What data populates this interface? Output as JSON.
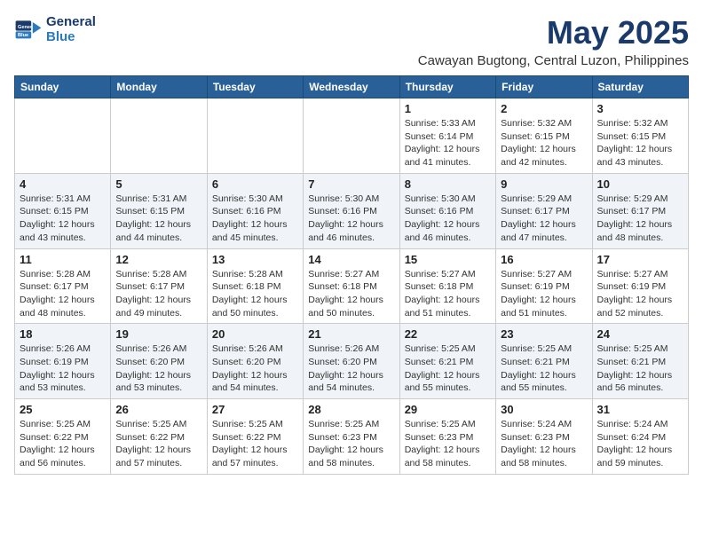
{
  "logo": {
    "line1": "General",
    "line2": "Blue"
  },
  "title": "May 2025",
  "subtitle": "Cawayan Bugtong, Central Luzon, Philippines",
  "days_of_week": [
    "Sunday",
    "Monday",
    "Tuesday",
    "Wednesday",
    "Thursday",
    "Friday",
    "Saturday"
  ],
  "weeks": [
    [
      {
        "day": "",
        "info": ""
      },
      {
        "day": "",
        "info": ""
      },
      {
        "day": "",
        "info": ""
      },
      {
        "day": "",
        "info": ""
      },
      {
        "day": "1",
        "info": "Sunrise: 5:33 AM\nSunset: 6:14 PM\nDaylight: 12 hours\nand 41 minutes."
      },
      {
        "day": "2",
        "info": "Sunrise: 5:32 AM\nSunset: 6:15 PM\nDaylight: 12 hours\nand 42 minutes."
      },
      {
        "day": "3",
        "info": "Sunrise: 5:32 AM\nSunset: 6:15 PM\nDaylight: 12 hours\nand 43 minutes."
      }
    ],
    [
      {
        "day": "4",
        "info": "Sunrise: 5:31 AM\nSunset: 6:15 PM\nDaylight: 12 hours\nand 43 minutes."
      },
      {
        "day": "5",
        "info": "Sunrise: 5:31 AM\nSunset: 6:15 PM\nDaylight: 12 hours\nand 44 minutes."
      },
      {
        "day": "6",
        "info": "Sunrise: 5:30 AM\nSunset: 6:16 PM\nDaylight: 12 hours\nand 45 minutes."
      },
      {
        "day": "7",
        "info": "Sunrise: 5:30 AM\nSunset: 6:16 PM\nDaylight: 12 hours\nand 46 minutes."
      },
      {
        "day": "8",
        "info": "Sunrise: 5:30 AM\nSunset: 6:16 PM\nDaylight: 12 hours\nand 46 minutes."
      },
      {
        "day": "9",
        "info": "Sunrise: 5:29 AM\nSunset: 6:17 PM\nDaylight: 12 hours\nand 47 minutes."
      },
      {
        "day": "10",
        "info": "Sunrise: 5:29 AM\nSunset: 6:17 PM\nDaylight: 12 hours\nand 48 minutes."
      }
    ],
    [
      {
        "day": "11",
        "info": "Sunrise: 5:28 AM\nSunset: 6:17 PM\nDaylight: 12 hours\nand 48 minutes."
      },
      {
        "day": "12",
        "info": "Sunrise: 5:28 AM\nSunset: 6:17 PM\nDaylight: 12 hours\nand 49 minutes."
      },
      {
        "day": "13",
        "info": "Sunrise: 5:28 AM\nSunset: 6:18 PM\nDaylight: 12 hours\nand 50 minutes."
      },
      {
        "day": "14",
        "info": "Sunrise: 5:27 AM\nSunset: 6:18 PM\nDaylight: 12 hours\nand 50 minutes."
      },
      {
        "day": "15",
        "info": "Sunrise: 5:27 AM\nSunset: 6:18 PM\nDaylight: 12 hours\nand 51 minutes."
      },
      {
        "day": "16",
        "info": "Sunrise: 5:27 AM\nSunset: 6:19 PM\nDaylight: 12 hours\nand 51 minutes."
      },
      {
        "day": "17",
        "info": "Sunrise: 5:27 AM\nSunset: 6:19 PM\nDaylight: 12 hours\nand 52 minutes."
      }
    ],
    [
      {
        "day": "18",
        "info": "Sunrise: 5:26 AM\nSunset: 6:19 PM\nDaylight: 12 hours\nand 53 minutes."
      },
      {
        "day": "19",
        "info": "Sunrise: 5:26 AM\nSunset: 6:20 PM\nDaylight: 12 hours\nand 53 minutes."
      },
      {
        "day": "20",
        "info": "Sunrise: 5:26 AM\nSunset: 6:20 PM\nDaylight: 12 hours\nand 54 minutes."
      },
      {
        "day": "21",
        "info": "Sunrise: 5:26 AM\nSunset: 6:20 PM\nDaylight: 12 hours\nand 54 minutes."
      },
      {
        "day": "22",
        "info": "Sunrise: 5:25 AM\nSunset: 6:21 PM\nDaylight: 12 hours\nand 55 minutes."
      },
      {
        "day": "23",
        "info": "Sunrise: 5:25 AM\nSunset: 6:21 PM\nDaylight: 12 hours\nand 55 minutes."
      },
      {
        "day": "24",
        "info": "Sunrise: 5:25 AM\nSunset: 6:21 PM\nDaylight: 12 hours\nand 56 minutes."
      }
    ],
    [
      {
        "day": "25",
        "info": "Sunrise: 5:25 AM\nSunset: 6:22 PM\nDaylight: 12 hours\nand 56 minutes."
      },
      {
        "day": "26",
        "info": "Sunrise: 5:25 AM\nSunset: 6:22 PM\nDaylight: 12 hours\nand 57 minutes."
      },
      {
        "day": "27",
        "info": "Sunrise: 5:25 AM\nSunset: 6:22 PM\nDaylight: 12 hours\nand 57 minutes."
      },
      {
        "day": "28",
        "info": "Sunrise: 5:25 AM\nSunset: 6:23 PM\nDaylight: 12 hours\nand 58 minutes."
      },
      {
        "day": "29",
        "info": "Sunrise: 5:25 AM\nSunset: 6:23 PM\nDaylight: 12 hours\nand 58 minutes."
      },
      {
        "day": "30",
        "info": "Sunrise: 5:24 AM\nSunset: 6:23 PM\nDaylight: 12 hours\nand 58 minutes."
      },
      {
        "day": "31",
        "info": "Sunrise: 5:24 AM\nSunset: 6:24 PM\nDaylight: 12 hours\nand 59 minutes."
      }
    ]
  ]
}
